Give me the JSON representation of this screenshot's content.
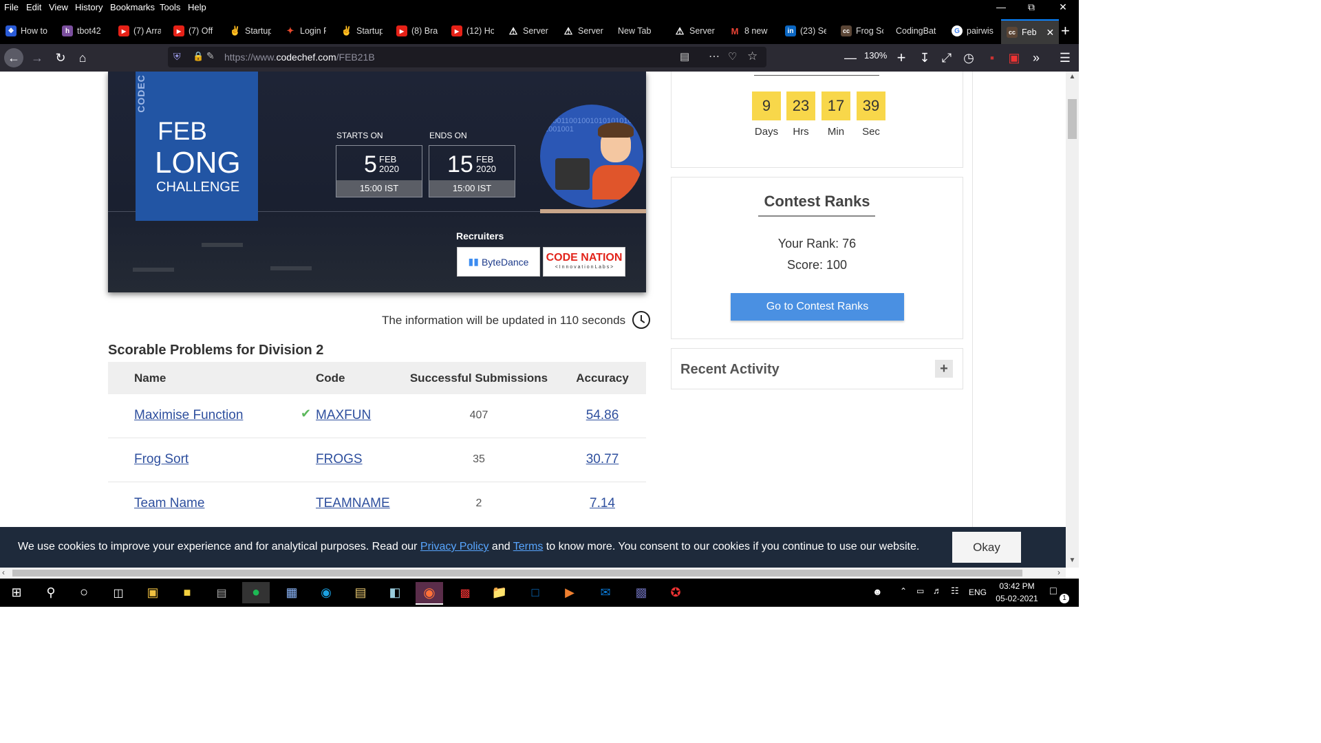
{
  "menubar": {
    "items": [
      "File",
      "Edit",
      "View",
      "History",
      "Bookmarks",
      "Tools",
      "Help"
    ]
  },
  "tabs": [
    {
      "label": "How to",
      "fav_color": "#2a5bd7",
      "fav_text": "❖"
    },
    {
      "label": "tbot42",
      "fav_color": "#7b4f9e",
      "fav_text": "h"
    },
    {
      "label": "(7) Arra",
      "fav_color": "#e62117",
      "fav_text": "▶"
    },
    {
      "label": "(7) Off",
      "fav_color": "#e62117",
      "fav_text": "▶"
    },
    {
      "label": "Startup",
      "fav_color": "#000",
      "fav_text": "✌"
    },
    {
      "label": "Login F",
      "fav_color": "#000",
      "fav_text": "✦"
    },
    {
      "label": "Startup",
      "fav_color": "#000",
      "fav_text": "✌"
    },
    {
      "label": "(8) Bra",
      "fav_color": "#e62117",
      "fav_text": "▶"
    },
    {
      "label": "(12) Ho",
      "fav_color": "#e62117",
      "fav_text": "▶"
    },
    {
      "label": "Server",
      "fav_color": "#000",
      "fav_text": "⚠"
    },
    {
      "label": "Server",
      "fav_color": "#000",
      "fav_text": "⚠"
    },
    {
      "label": "New Tab",
      "fav_color": "",
      "fav_text": ""
    },
    {
      "label": "Server",
      "fav_color": "#000",
      "fav_text": "⚠"
    },
    {
      "label": "8 new",
      "fav_color": "#fff",
      "fav_text": "M"
    },
    {
      "label": "(23) Se",
      "fav_color": "#0a66c2",
      "fav_text": "in"
    },
    {
      "label": "Frog So",
      "fav_color": "#5b4636",
      "fav_text": "cc"
    },
    {
      "label": "CodingBat",
      "fav_color": "",
      "fav_text": ""
    },
    {
      "label": "pairwis",
      "fav_color": "#fff",
      "fav_text": "G"
    },
    {
      "label": "Feb",
      "fav_color": "#5b4636",
      "fav_text": "cc"
    }
  ],
  "nav": {
    "url_prefix": "https://www.",
    "url_domain": "codechef.com",
    "url_path": "/FEB21B",
    "zoom": "130%"
  },
  "banner": {
    "brand": "CODEC",
    "line1": "FEB",
    "line2": "LONG",
    "line3": "CHALLENGE",
    "starts_label": "STARTS ON",
    "ends_label": "ENDS ON",
    "start_day": "5",
    "start_month": "FEB",
    "start_year": "2020",
    "start_time": "15:00 IST",
    "end_day": "15",
    "end_month": "FEB",
    "end_year": "2020",
    "end_time": "15:00 IST",
    "recruiters_label": "Recruiters",
    "bytedance": "ByteDance",
    "codenation": "CODE NATION",
    "codenation_sub": "< I n n o v a t i o n  L a b s >",
    "binary": "010011001001010101010001001001"
  },
  "update_info": "The information will be updated in 110 seconds",
  "section_title": "Scorable Problems for Division 2",
  "table": {
    "headers": [
      "Name",
      "Code",
      "Successful Submissions",
      "Accuracy"
    ],
    "rows": [
      {
        "name": "Maximise Function",
        "code": "MAXFUN",
        "subs": "407",
        "acc": "54.86"
      },
      {
        "name": "Frog Sort",
        "code": "FROGS",
        "subs": "35",
        "acc": "30.77"
      },
      {
        "name": "Team Name",
        "code": "TEAMNAME",
        "subs": "2",
        "acc": "7.14"
      }
    ]
  },
  "countdown": {
    "days": "9",
    "hrs": "23",
    "min": "17",
    "sec": "39",
    "days_label": "Days",
    "hrs_label": "Hrs",
    "min_label": "Min",
    "sec_label": "Sec"
  },
  "ranks": {
    "title": "Contest Ranks",
    "your_rank": "Your Rank: 76",
    "score": "Score: 100",
    "button": "Go to Contest Ranks"
  },
  "recent": {
    "title": "Recent Activity",
    "toggle": "+"
  },
  "cookie": {
    "pre": "We use cookies to improve your experience and for analytical purposes. Read our ",
    "privacy": "Privacy Policy",
    "mid": " and ",
    "terms": "Terms",
    "post": " to know more. You consent to our cookies if you continue to use our website.",
    "okay": "Okay"
  },
  "taskbar": {
    "lang": "ENG",
    "time": "03:42 PM",
    "date": "05-02-2021",
    "notif": "1"
  },
  "colors": {
    "accent": "#4a90e2",
    "link": "#2e4f9e",
    "countdown": "#f8d74a",
    "banner_blue": "#2255a4"
  }
}
